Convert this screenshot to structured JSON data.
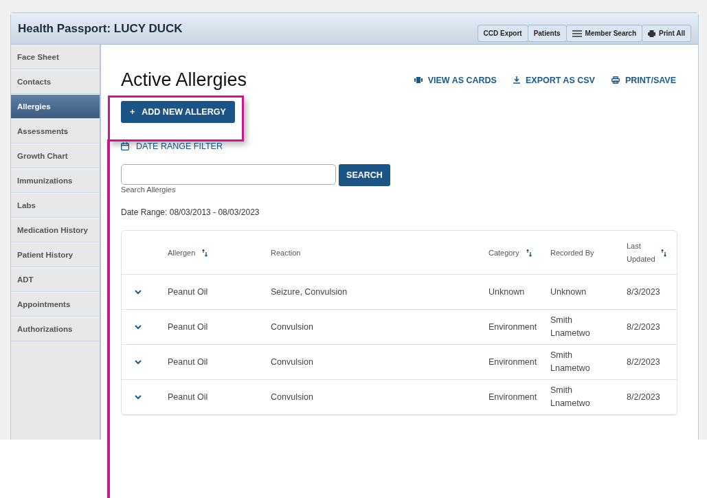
{
  "window": {
    "title": "Health Passport: LUCY DUCK"
  },
  "toolbar": [
    {
      "label": "CCD Export",
      "kind": "plain"
    },
    {
      "label": "Patients",
      "kind": "plain"
    },
    {
      "label": "Member Search",
      "kind": "menu"
    },
    {
      "label": "Print All",
      "kind": "print"
    }
  ],
  "sidebar": {
    "items": [
      {
        "label": "Face Sheet",
        "selected": false
      },
      {
        "label": "Contacts",
        "selected": false
      },
      {
        "label": "Allergies",
        "selected": true
      },
      {
        "label": "Assessments",
        "selected": false
      },
      {
        "label": "Growth Chart",
        "selected": false
      },
      {
        "label": "Immunizations",
        "selected": false
      },
      {
        "label": "Labs",
        "selected": false
      },
      {
        "label": "Medication History",
        "selected": false
      },
      {
        "label": "Patient History",
        "selected": false
      },
      {
        "label": "ADT",
        "selected": false
      },
      {
        "label": "Appointments",
        "selected": false
      },
      {
        "label": "Authorizations",
        "selected": false
      }
    ]
  },
  "main": {
    "heading": "Active Allergies",
    "actions": [
      {
        "label": "VIEW AS CARDS",
        "kind": "cards"
      },
      {
        "label": "EXPORT AS CSV",
        "kind": "download"
      },
      {
        "label": "PRINT/SAVE",
        "kind": "print"
      }
    ],
    "add_button": {
      "icon": "+",
      "label": "ADD NEW ALLERGY"
    },
    "date_filter": "DATE RANGE FILTER",
    "search": {
      "caption": "Search Allergies",
      "button": "SEARCH"
    },
    "date_range": "Date Range: 08/03/2013 - 08/03/2023",
    "table": {
      "columns": [
        {
          "label": "Allergen",
          "sortable": true
        },
        {
          "label": "Reaction",
          "sortable": false
        },
        {
          "label": "Category",
          "sortable": true
        },
        {
          "label": "Recorded By",
          "sortable": false
        },
        {
          "label": "Last Updated",
          "sortable": true
        }
      ],
      "rows": [
        {
          "expanded": false,
          "cells": [
            "Peanut Oil",
            "Seizure, Convulsion",
            "Unknown",
            "Unknown",
            "8/3/2023"
          ]
        },
        {
          "expanded": false,
          "cells": [
            "Peanut Oil",
            "Convulsion",
            "Environment",
            "Smith Lnametwo",
            "8/2/2023"
          ]
        },
        {
          "expanded": false,
          "cells": [
            "Peanut Oil",
            "Convulsion",
            "Environment",
            "Smith Lnametwo",
            "8/2/2023"
          ]
        },
        {
          "expanded": false,
          "cells": [
            "Peanut Oil",
            "Convulsion",
            "Environment",
            "Smith Lnametwo",
            "8/2/2023"
          ]
        }
      ]
    }
  }
}
